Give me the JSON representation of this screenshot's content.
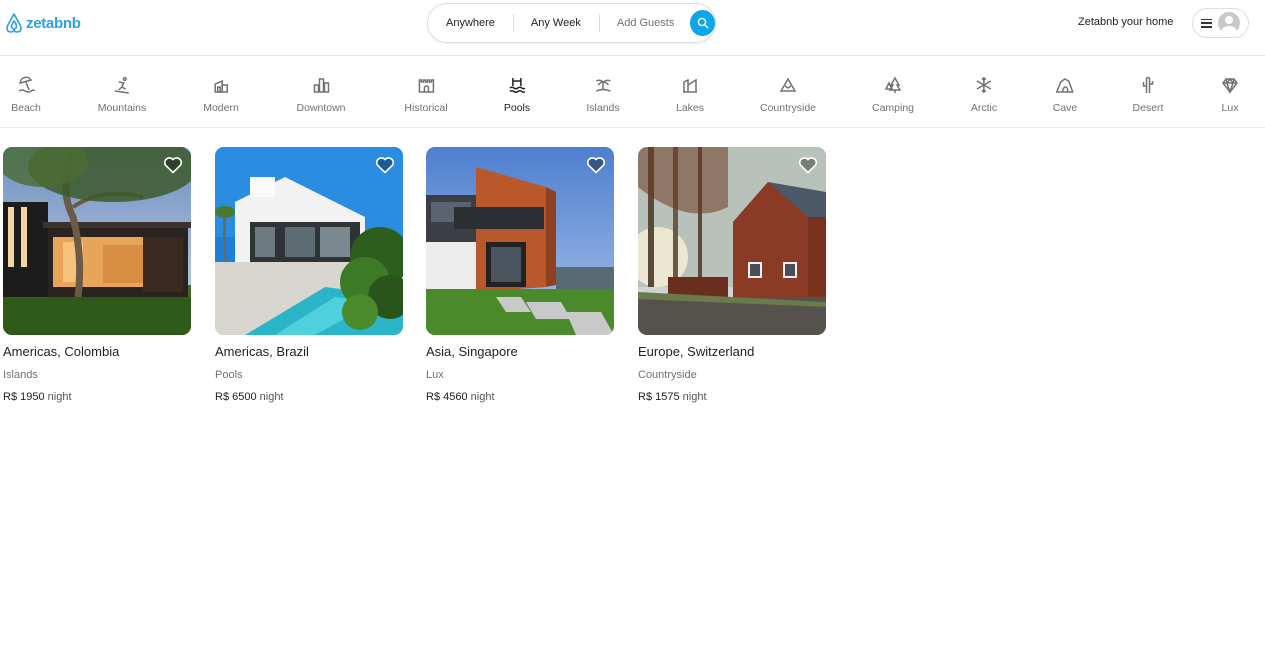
{
  "brand": {
    "name": "zetabnb",
    "color": "#2aa1e0"
  },
  "search": {
    "where": "Anywhere",
    "when": "Any Week",
    "guests": "Add Guests",
    "button_color": "#0ea5e9"
  },
  "header": {
    "host_link": "Zetabnb your home"
  },
  "categories": [
    {
      "label": "Beach",
      "icon": "beach-icon"
    },
    {
      "label": "Mountains",
      "icon": "skier-icon"
    },
    {
      "label": "Modern",
      "icon": "modern-house-icon"
    },
    {
      "label": "Downtown",
      "icon": "city-icon"
    },
    {
      "label": "Historical",
      "icon": "castle-icon"
    },
    {
      "label": "Pools",
      "icon": "pool-icon",
      "active": true
    },
    {
      "label": "Islands",
      "icon": "palm-island-icon"
    },
    {
      "label": "Lakes",
      "icon": "lake-icon"
    },
    {
      "label": "Countryside",
      "icon": "mountain-peak-icon"
    },
    {
      "label": "Camping",
      "icon": "pine-trees-icon"
    },
    {
      "label": "Arctic",
      "icon": "snowflake-icon"
    },
    {
      "label": "Cave",
      "icon": "cave-icon"
    },
    {
      "label": "Desert",
      "icon": "cactus-icon"
    },
    {
      "label": "Lux",
      "icon": "diamond-icon"
    }
  ],
  "listings": [
    {
      "location": "Americas, Colombia",
      "category": "Islands",
      "price": "R$ 1950",
      "unit": "night"
    },
    {
      "location": "Americas, Brazil",
      "category": "Pools",
      "price": "R$ 6500",
      "unit": "night"
    },
    {
      "location": "Asia, Singapore",
      "category": "Lux",
      "price": "R$ 4560",
      "unit": "night"
    },
    {
      "location": "Europe, Switzerland",
      "category": "Countryside",
      "price": "R$ 1575",
      "unit": "night"
    }
  ]
}
